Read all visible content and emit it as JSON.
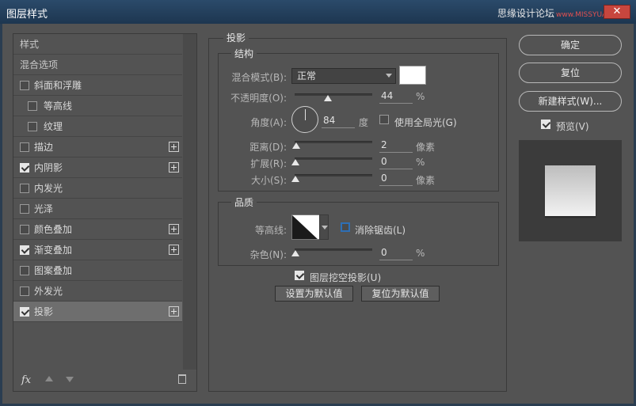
{
  "window": {
    "title": "图层样式",
    "watermark_text": "思缘设计论坛",
    "watermark_site": "www.MISSYUAN.COM",
    "close_glyph": "✕"
  },
  "left": {
    "items": [
      {
        "label": "样式",
        "type": "head"
      },
      {
        "label": "混合选项",
        "type": "head"
      },
      {
        "label": "斜面和浮雕",
        "checked": false,
        "plus": false
      },
      {
        "label": "等高线",
        "checked": false,
        "sub": true
      },
      {
        "label": "纹理",
        "checked": false,
        "sub": true
      },
      {
        "label": "描边",
        "checked": false,
        "plus": true
      },
      {
        "label": "内阴影",
        "checked": true,
        "plus": true
      },
      {
        "label": "内发光",
        "checked": false,
        "plus": false
      },
      {
        "label": "光泽",
        "checked": false,
        "plus": false
      },
      {
        "label": "颜色叠加",
        "checked": false,
        "plus": true
      },
      {
        "label": "渐变叠加",
        "checked": true,
        "plus": true
      },
      {
        "label": "图案叠加",
        "checked": false,
        "plus": false
      },
      {
        "label": "外发光",
        "checked": false,
        "plus": false
      },
      {
        "label": "投影",
        "checked": true,
        "plus": true,
        "active": true
      }
    ],
    "fx_label": "fx"
  },
  "center": {
    "section_title": "投影",
    "structure": {
      "title": "结构",
      "blend_mode_label": "混合模式(B):",
      "blend_mode_value": "正常",
      "opacity_label": "不透明度(O):",
      "opacity_value": "44",
      "opacity_unit": "%",
      "angle_label": "角度(A):",
      "angle_value": "84",
      "angle_unit": "度",
      "global_light_label": "使用全局光(G)",
      "global_light_checked": false,
      "distance_label": "距离(D):",
      "distance_value": "2",
      "distance_unit": "像素",
      "spread_label": "扩展(R):",
      "spread_value": "0",
      "spread_unit": "%",
      "size_label": "大小(S):",
      "size_value": "0",
      "size_unit": "像素",
      "color_swatch": "#ffffff"
    },
    "quality": {
      "title": "品质",
      "contour_label": "等高线:",
      "antialias_label": "消除锯齿(L)",
      "noise_label": "杂色(N):",
      "noise_value": "0",
      "noise_unit": "%"
    },
    "knockout_label": "图层挖空投影(U)",
    "knockout_checked": true,
    "make_default_label": "设置为默认值",
    "reset_default_label": "复位为默认值"
  },
  "right": {
    "ok_label": "确定",
    "reset_label": "复位",
    "new_style_label": "新建样式(W)...",
    "preview_label": "预览(V)",
    "preview_checked": true
  }
}
